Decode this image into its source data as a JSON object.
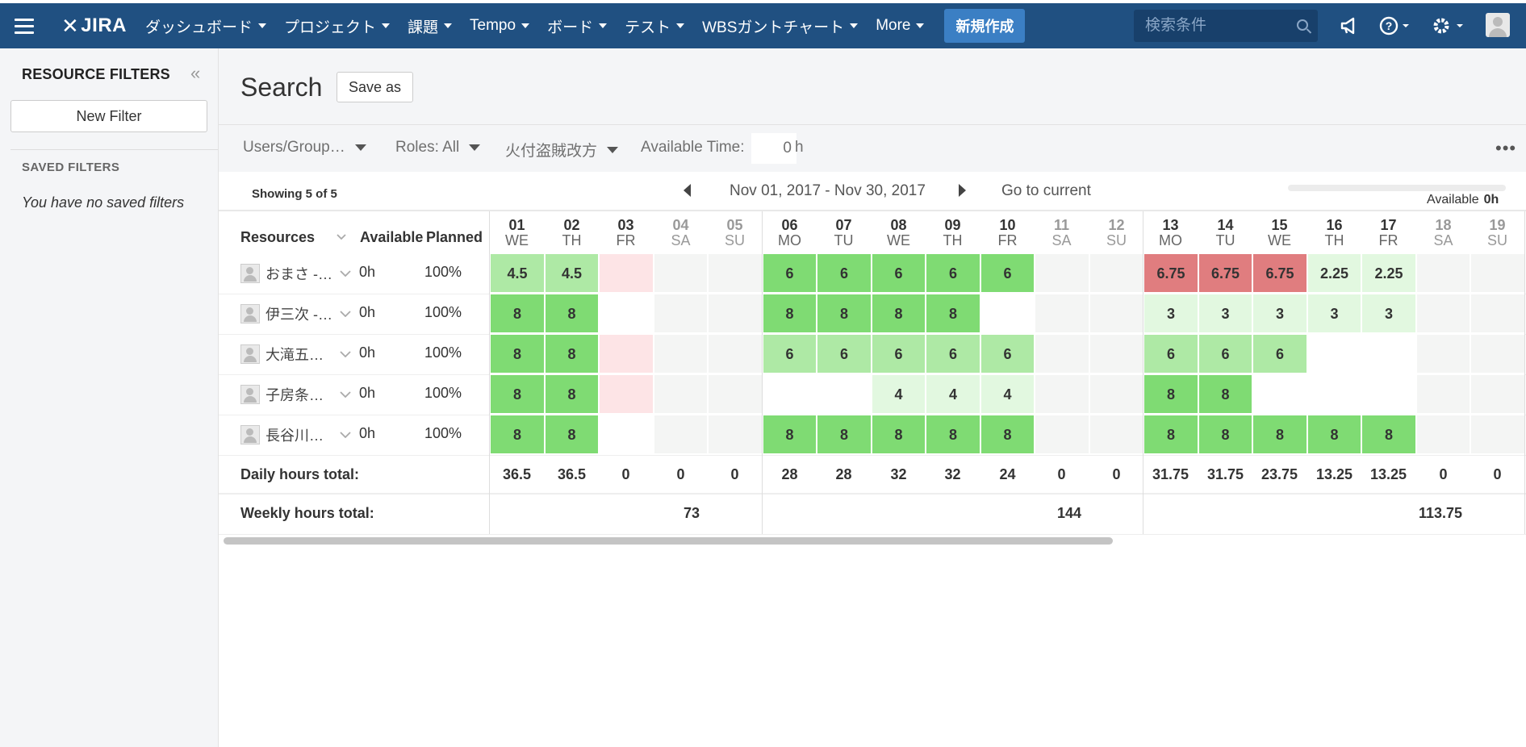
{
  "nav": {
    "logo": "JIRA",
    "items": [
      "ダッシュボード",
      "プロジェクト",
      "課題",
      "Tempo",
      "ボード",
      "テスト",
      "WBSガントチャート",
      "More"
    ],
    "create": "新規作成",
    "search_placeholder": "検索条件",
    "icons": [
      "menu-icon",
      "megaphone-icon",
      "help-icon",
      "gear-icon",
      "avatar"
    ]
  },
  "sidebar": {
    "title": "RESOURCE FILTERS",
    "new_filter": "New Filter",
    "saved_title": "SAVED FILTERS",
    "saved_empty": "You have no saved filters"
  },
  "page": {
    "title": "Search",
    "save_as": "Save as"
  },
  "filters": {
    "users": "Users/Group…",
    "roles": "Roles: All",
    "group": "火付盗賊改方",
    "available_label": "Available Time:",
    "available_value": "0",
    "available_unit": "h"
  },
  "calendar": {
    "showing": "Showing 5 of 5",
    "range": "Nov 01, 2017 - Nov 30, 2017",
    "goto": "Go to current",
    "available_label": "Available",
    "available_value": "0h"
  },
  "table": {
    "headers": {
      "resources": "Resources",
      "available": "Available",
      "planned": "Planned"
    },
    "days": [
      {
        "num": "01",
        "dow": "WE",
        "weekend": false
      },
      {
        "num": "02",
        "dow": "TH",
        "weekend": false
      },
      {
        "num": "03",
        "dow": "FR",
        "weekend": false
      },
      {
        "num": "04",
        "dow": "SA",
        "weekend": true
      },
      {
        "num": "05",
        "dow": "SU",
        "weekend": true
      },
      {
        "num": "06",
        "dow": "MO",
        "weekend": false
      },
      {
        "num": "07",
        "dow": "TU",
        "weekend": false
      },
      {
        "num": "08",
        "dow": "WE",
        "weekend": false
      },
      {
        "num": "09",
        "dow": "TH",
        "weekend": false
      },
      {
        "num": "10",
        "dow": "FR",
        "weekend": false
      },
      {
        "num": "11",
        "dow": "SA",
        "weekend": true
      },
      {
        "num": "12",
        "dow": "SU",
        "weekend": true
      },
      {
        "num": "13",
        "dow": "MO",
        "weekend": false
      },
      {
        "num": "14",
        "dow": "TU",
        "weekend": false
      },
      {
        "num": "15",
        "dow": "WE",
        "weekend": false
      },
      {
        "num": "16",
        "dow": "TH",
        "weekend": false
      },
      {
        "num": "17",
        "dow": "FR",
        "weekend": false
      },
      {
        "num": "18",
        "dow": "SA",
        "weekend": true
      },
      {
        "num": "19",
        "dow": "SU",
        "weekend": true
      }
    ],
    "rows": [
      {
        "name": "おまさ -…",
        "available": "0h",
        "planned": "100%",
        "cells": [
          [
            "4.5",
            "light"
          ],
          [
            "4.5",
            "light"
          ],
          [
            "",
            "red"
          ],
          [
            "",
            "weekend"
          ],
          [
            "",
            "weekend"
          ],
          [
            "6",
            "mid"
          ],
          [
            "6",
            "mid"
          ],
          [
            "6",
            "mid"
          ],
          [
            "6",
            "mid"
          ],
          [
            "6",
            "mid"
          ],
          [
            "",
            "weekend"
          ],
          [
            "",
            "weekend"
          ],
          [
            "6.75",
            "over"
          ],
          [
            "6.75",
            "over"
          ],
          [
            "6.75",
            "over"
          ],
          [
            "2.25",
            "pale"
          ],
          [
            "2.25",
            "pale"
          ],
          [
            "",
            "weekend"
          ],
          [
            "",
            "weekend"
          ]
        ]
      },
      {
        "name": "伊三次 -…",
        "available": "0h",
        "planned": "100%",
        "cells": [
          [
            "8",
            "mid"
          ],
          [
            "8",
            "mid"
          ],
          [
            "",
            "empty"
          ],
          [
            "",
            "weekend"
          ],
          [
            "",
            "weekend"
          ],
          [
            "8",
            "mid"
          ],
          [
            "8",
            "mid"
          ],
          [
            "8",
            "mid"
          ],
          [
            "8",
            "mid"
          ],
          [
            "",
            "empty"
          ],
          [
            "",
            "weekend"
          ],
          [
            "",
            "weekend"
          ],
          [
            "3",
            "pale"
          ],
          [
            "3",
            "pale"
          ],
          [
            "3",
            "pale"
          ],
          [
            "3",
            "pale"
          ],
          [
            "3",
            "pale"
          ],
          [
            "",
            "weekend"
          ],
          [
            "",
            "weekend"
          ]
        ]
      },
      {
        "name": "大滝五…",
        "available": "0h",
        "planned": "100%",
        "cells": [
          [
            "8",
            "mid"
          ],
          [
            "8",
            "mid"
          ],
          [
            "",
            "red"
          ],
          [
            "",
            "weekend"
          ],
          [
            "",
            "weekend"
          ],
          [
            "6",
            "light"
          ],
          [
            "6",
            "light"
          ],
          [
            "6",
            "light"
          ],
          [
            "6",
            "light"
          ],
          [
            "6",
            "light"
          ],
          [
            "",
            "weekend"
          ],
          [
            "",
            "weekend"
          ],
          [
            "6",
            "light"
          ],
          [
            "6",
            "light"
          ],
          [
            "6",
            "light"
          ],
          [
            "",
            "empty"
          ],
          [
            "",
            "empty"
          ],
          [
            "",
            "weekend"
          ],
          [
            "",
            "weekend"
          ]
        ]
      },
      {
        "name": "子房条…",
        "available": "0h",
        "planned": "100%",
        "cells": [
          [
            "8",
            "mid"
          ],
          [
            "8",
            "mid"
          ],
          [
            "",
            "red"
          ],
          [
            "",
            "weekend"
          ],
          [
            "",
            "weekend"
          ],
          [
            "",
            "empty"
          ],
          [
            "",
            "empty"
          ],
          [
            "4",
            "pale"
          ],
          [
            "4",
            "pale"
          ],
          [
            "4",
            "pale"
          ],
          [
            "",
            "weekend"
          ],
          [
            "",
            "weekend"
          ],
          [
            "8",
            "mid"
          ],
          [
            "8",
            "mid"
          ],
          [
            "",
            "empty"
          ],
          [
            "",
            "empty"
          ],
          [
            "",
            "empty"
          ],
          [
            "",
            "weekend"
          ],
          [
            "",
            "weekend"
          ]
        ]
      },
      {
        "name": "長谷川…",
        "available": "0h",
        "planned": "100%",
        "cells": [
          [
            "8",
            "mid"
          ],
          [
            "8",
            "mid"
          ],
          [
            "",
            "empty"
          ],
          [
            "",
            "weekend"
          ],
          [
            "",
            "weekend"
          ],
          [
            "8",
            "mid"
          ],
          [
            "8",
            "mid"
          ],
          [
            "8",
            "mid"
          ],
          [
            "8",
            "mid"
          ],
          [
            "8",
            "mid"
          ],
          [
            "",
            "weekend"
          ],
          [
            "",
            "weekend"
          ],
          [
            "8",
            "mid"
          ],
          [
            "8",
            "mid"
          ],
          [
            "8",
            "mid"
          ],
          [
            "8",
            "mid"
          ],
          [
            "8",
            "mid"
          ],
          [
            "",
            "weekend"
          ],
          [
            "",
            "weekend"
          ]
        ]
      }
    ],
    "daily_label": "Daily hours total:",
    "daily_totals": [
      "36.5",
      "36.5",
      "0",
      "0",
      "0",
      "28",
      "28",
      "32",
      "32",
      "24",
      "0",
      "0",
      "31.75",
      "31.75",
      "23.75",
      "13.25",
      "13.25",
      "0",
      "0"
    ],
    "weekly_label": "Weekly hours total:",
    "weekly_totals": [
      "73",
      "144",
      "113.75"
    ]
  },
  "colors": {
    "nav": "#205081",
    "create": "#3b7fc4",
    "pale": "#e2f8e0",
    "light": "#aee9a5",
    "mid": "#7fdb73",
    "over": "#e07d7f",
    "red": "#fde4e6"
  }
}
